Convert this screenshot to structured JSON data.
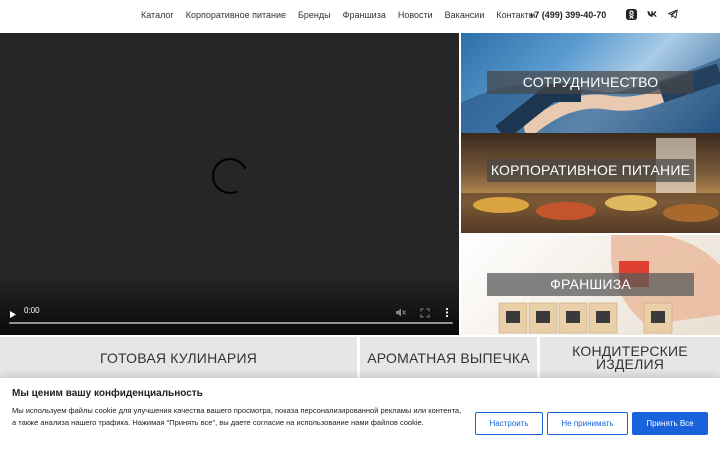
{
  "header": {
    "nav": [
      "Каталог",
      "Корпоративное питание",
      "Бренды",
      "Франшиза",
      "Новости",
      "Вакансии",
      "Контакты"
    ],
    "phone": "+7 (499) 399-40-70",
    "social_icons": [
      "odnoklassniki-icon",
      "vk-icon",
      "telegram-icon"
    ]
  },
  "video": {
    "time": "0:00",
    "progress": 0
  },
  "tiles": [
    "СОТРУДНИЧЕСТВО",
    "КОРПОРАТИВНОЕ ПИТАНИЕ",
    "ФРАНШИЗА"
  ],
  "categories": [
    "ГОТОВАЯ КУЛИНАРИЯ",
    "АРОМАТНАЯ ВЫПЕЧКА",
    "КОНДИТЕРСКИЕ ИЗДЕЛИЯ"
  ],
  "cookie": {
    "title": "Мы ценим вашу конфиденциальность",
    "text": "Мы используем файлы cookie для улучшения качества вашего просмотра, показа персонализированной рекламы или контента, а также анализа нашего трафика. Нажимая \"Принять все\", вы даете согласие на использование нами файлов cookie.",
    "customize": "Настроить",
    "reject": "Не принимать",
    "accept": "Принять Все"
  },
  "colors": {
    "accent": "#1863dc",
    "video_bg": "#262626",
    "category_bg": "#e6e6e6"
  }
}
